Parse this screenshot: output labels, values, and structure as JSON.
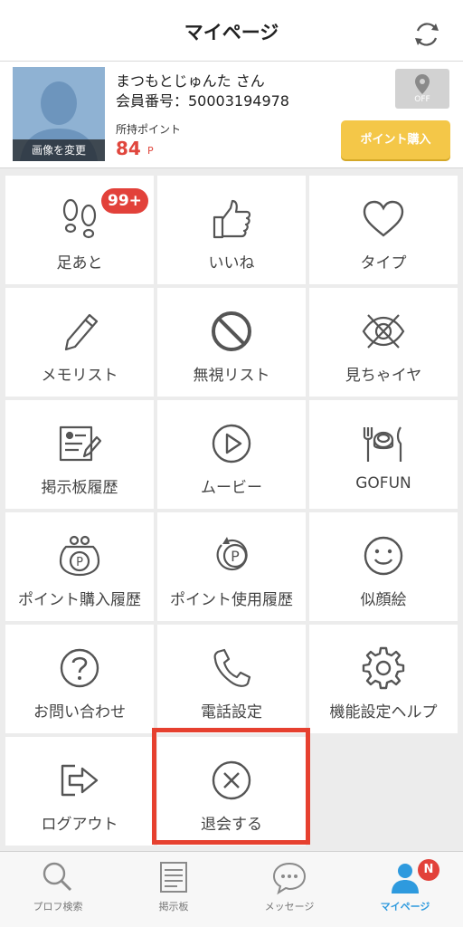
{
  "header": {
    "title": "マイページ",
    "refresh_icon": "refresh-icon"
  },
  "profile": {
    "name": "まつもとじゅんた さん",
    "member_id": "会員番号：50003194978",
    "change_photo": "画像を変更",
    "points_label": "所持ポイント",
    "points_value": "84",
    "points_unit": "P",
    "gps_state": "OFF",
    "buy_button": "ポイント購入"
  },
  "menu": [
    {
      "label": "足あと",
      "icon": "footprints-icon",
      "badge": "99+"
    },
    {
      "label": "いいね",
      "icon": "thumbs-up-icon"
    },
    {
      "label": "タイプ",
      "icon": "heart-icon"
    },
    {
      "label": "メモリスト",
      "icon": "pencil-icon"
    },
    {
      "label": "無視リスト",
      "icon": "block-icon"
    },
    {
      "label": "見ちゃイヤ",
      "icon": "eye-crossed-icon"
    },
    {
      "label": "掲示板履歴",
      "icon": "board-history-icon"
    },
    {
      "label": "ムービー",
      "icon": "play-icon"
    },
    {
      "label": "GOFUN",
      "icon": "meat-icon"
    },
    {
      "label": "ポイント購入履歴",
      "icon": "purse-icon"
    },
    {
      "label": "ポイント使用履歴",
      "icon": "point-usage-icon"
    },
    {
      "label": "似顔絵",
      "icon": "smile-icon"
    },
    {
      "label": "お問い合わせ",
      "icon": "question-icon"
    },
    {
      "label": "電話設定",
      "icon": "phone-icon"
    },
    {
      "label": "機能設定ヘルプ",
      "icon": "gear-icon"
    },
    {
      "label": "ログアウト",
      "icon": "logout-icon"
    },
    {
      "label": "退会する",
      "icon": "close-circle-icon"
    }
  ],
  "tabs": [
    {
      "label": "プロフ検索",
      "icon": "search-icon"
    },
    {
      "label": "掲示板",
      "icon": "bulletin-board-icon"
    },
    {
      "label": "メッセージ",
      "icon": "message-icon"
    },
    {
      "label": "マイページ",
      "icon": "person-icon",
      "badge": "N",
      "active": true
    }
  ],
  "colors": {
    "accent_red": "#e2413a",
    "buy_yellow": "#f4c748",
    "active_blue": "#2e9ade",
    "highlight": "#e6402f"
  }
}
